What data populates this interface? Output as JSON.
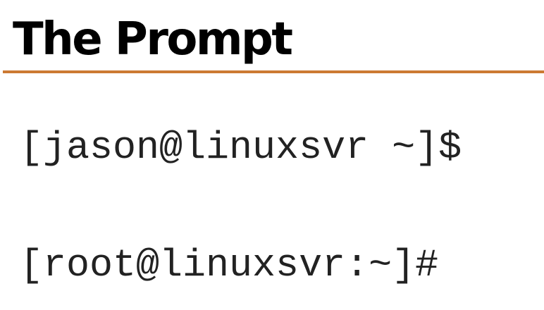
{
  "slide": {
    "title": "The Prompt",
    "accent_color": "#cc7a33",
    "prompts": {
      "user": "[jason@linuxsvr ~]$",
      "root": "[root@linuxsvr:~]#"
    }
  }
}
